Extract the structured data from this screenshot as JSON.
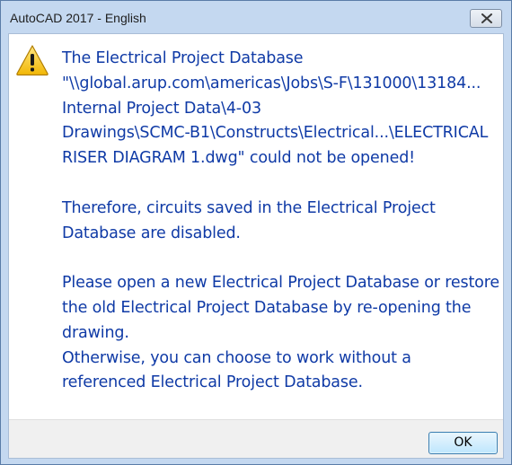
{
  "window": {
    "title": "AutoCAD 2017 - English"
  },
  "icons": {
    "close": "close-icon",
    "warning": "warning-icon"
  },
  "message": {
    "lines_p1": [
      "The Electrical Project Database",
      "\"\\\\global.arup.com\\americas\\Jobs\\S-F\\131000\\13184...",
      "Internal Project Data\\4-03",
      "Drawings\\SCMC-B1\\Constructs\\Electrical...\\ELECTRICAL",
      "RISER DIAGRAM 1.dwg\" could not be opened!"
    ],
    "lines_p2": [
      "Therefore, circuits saved in the Electrical Project",
      "Database are disabled."
    ],
    "lines_p3": [
      "Please open a new Electrical Project Database or restore",
      "the old Electrical Project Database by re-opening the",
      "drawing.",
      "Otherwise, you can choose to work without a",
      "referenced Electrical Project Database."
    ]
  },
  "buttons": {
    "ok_label": "OK"
  },
  "colors": {
    "message_text": "#0f3aa6",
    "title_bar": "#c4d8f0",
    "footer": "#f0f0f0"
  }
}
